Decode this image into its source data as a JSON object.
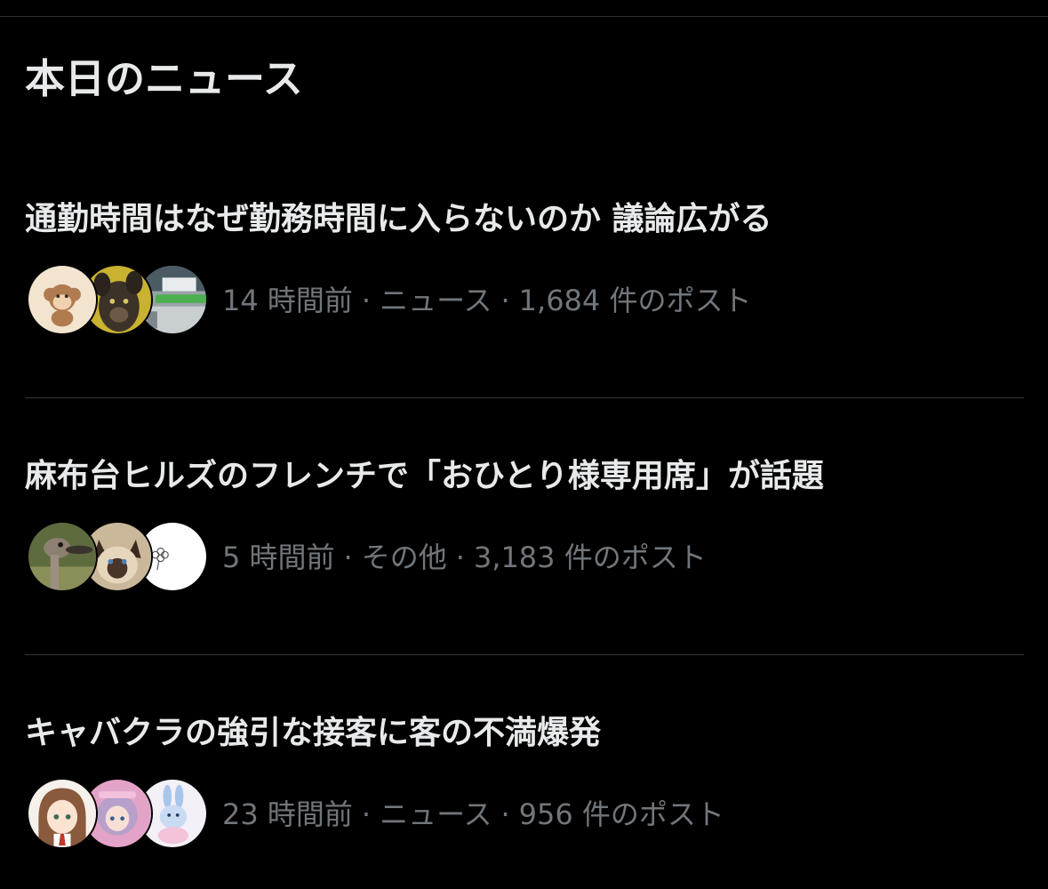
{
  "section": {
    "title": "本日のニュース"
  },
  "separator": "·",
  "news": [
    {
      "headline": "通勤時間はなぜ勤務時間に入らないのか 議論広がる",
      "time": "14 時間前",
      "category": "ニュース",
      "post_count": "1,684 件のポスト",
      "avatars": [
        "monkey-avatar",
        "dog-avatar",
        "street-sign-avatar"
      ]
    },
    {
      "headline": "麻布台ヒルズのフレンチで「おひとり様専用席」が話題",
      "time": "5 時間前",
      "category": "その他",
      "post_count": "3,183 件のポスト",
      "avatars": [
        "ostrich-avatar",
        "cat-avatar",
        "flower-sketch-avatar"
      ]
    },
    {
      "headline": "キャバクラの強引な接客に客の不満爆発",
      "time": "23 時間前",
      "category": "ニュース",
      "post_count": "956 件のポスト",
      "avatars": [
        "anime-girl-avatar",
        "anime-character-avatar",
        "bunny-illustration-avatar"
      ]
    }
  ],
  "colors": {
    "background": "#000000",
    "primary_text": "#e7e9ea",
    "secondary_text": "#71767b",
    "divider": "#2f3336"
  }
}
